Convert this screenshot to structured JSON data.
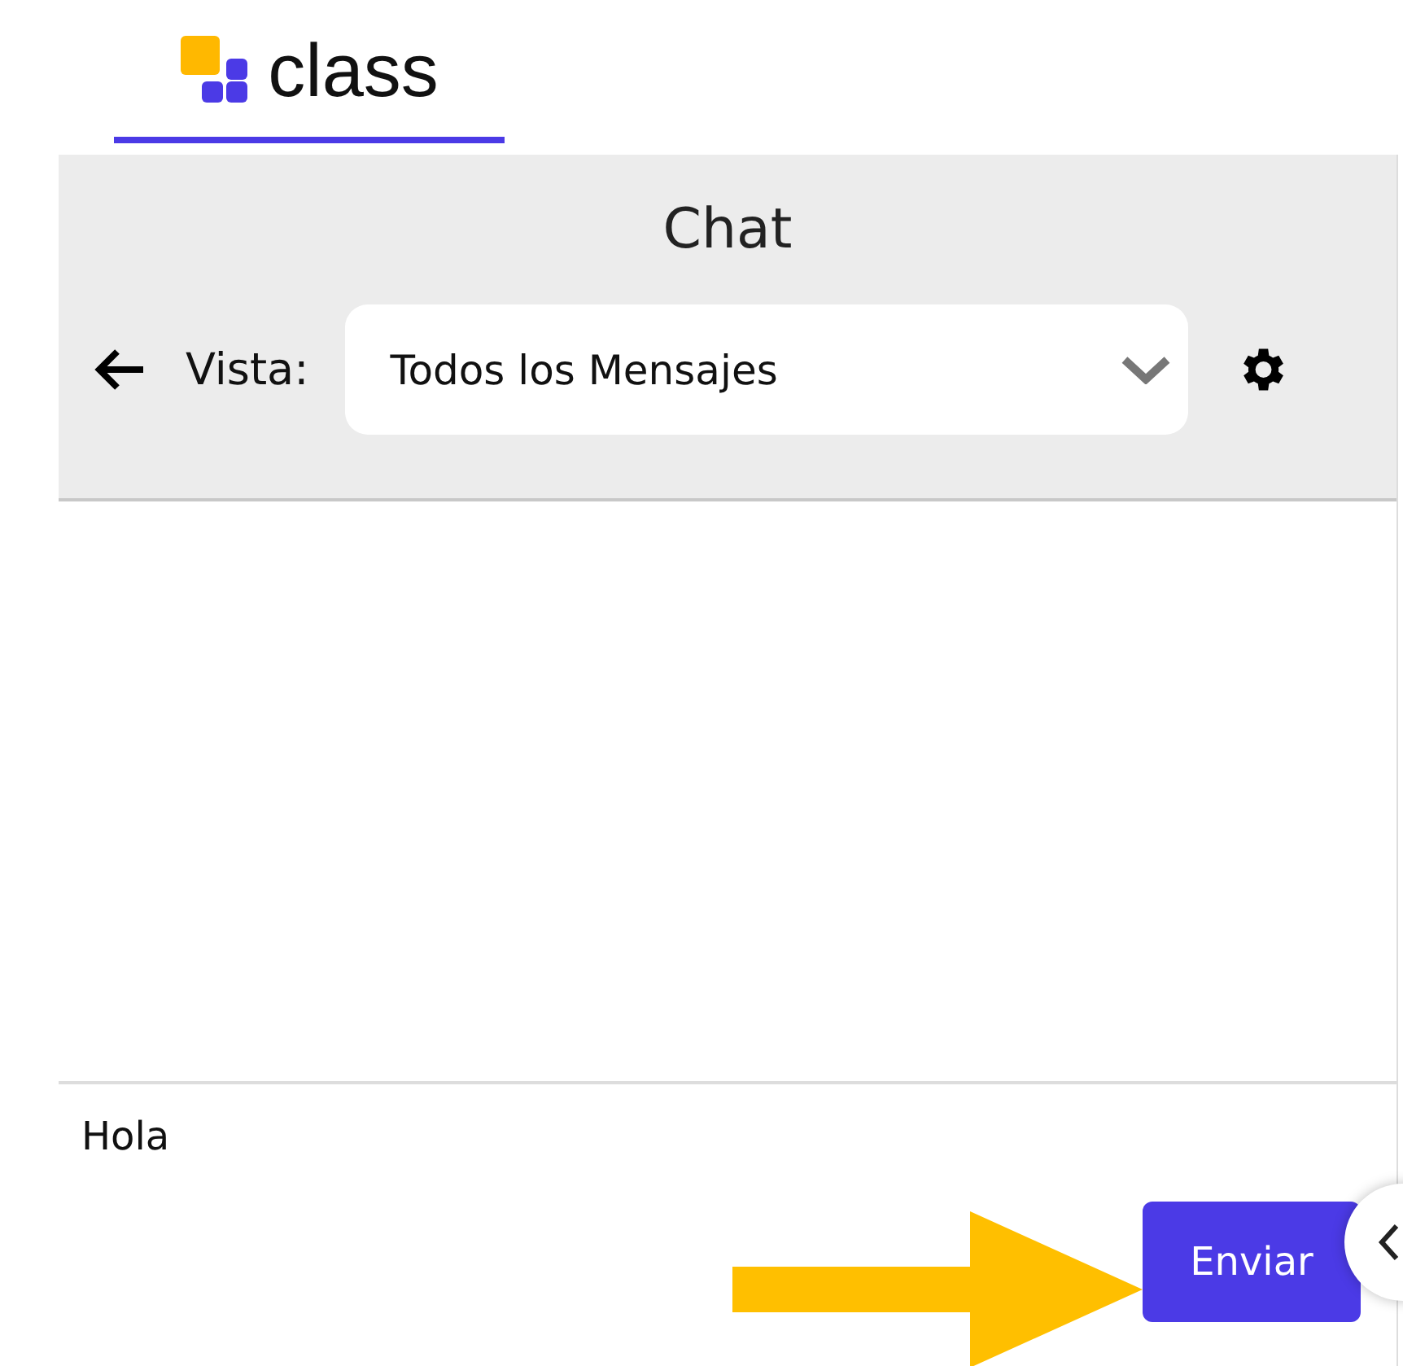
{
  "logo": {
    "text": "class"
  },
  "chat": {
    "title": "Chat",
    "view_label": "Vista:",
    "view_select": {
      "value": "Todos los Mensajes"
    }
  },
  "composer": {
    "value": "Hola",
    "send_button": "Enviar"
  }
}
